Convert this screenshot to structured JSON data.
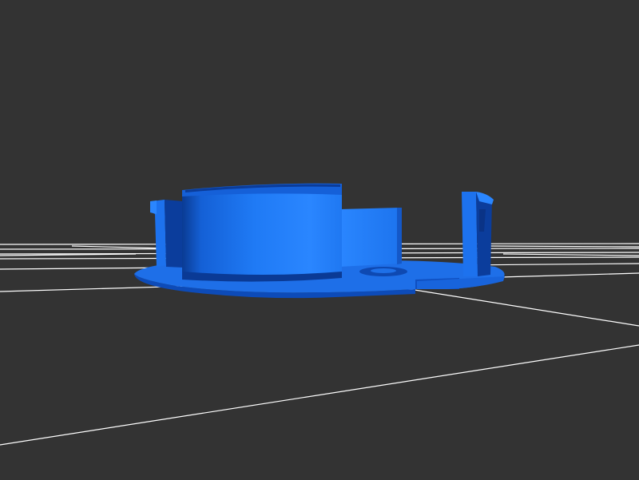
{
  "scene": {
    "background_color": "#333333",
    "grid_color": "#ffffff",
    "model_color": "#1a72f0",
    "model_shadow_color": "#0b3f9a",
    "model_highlight_color": "#2d8bff"
  }
}
